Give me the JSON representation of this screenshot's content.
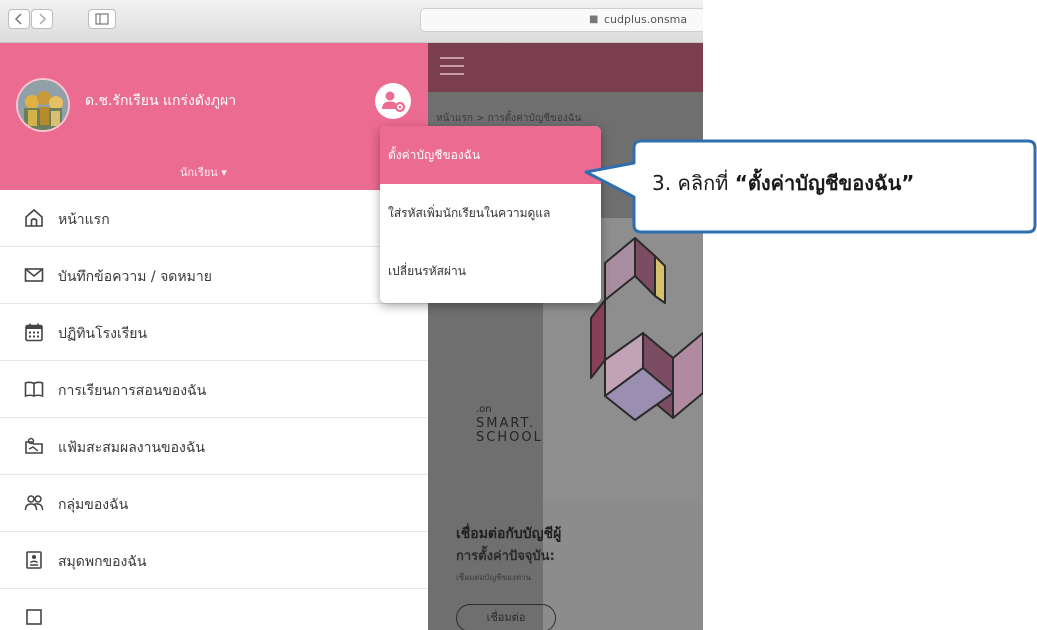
{
  "browser": {
    "url": "cudplus.onsma"
  },
  "sidebar": {
    "user_name": "ด.ช.รักเรียน แกร่งดังภูผา",
    "role": "นักเรียน ▾",
    "items": [
      {
        "label": "หน้าแรก",
        "icon": "home-icon"
      },
      {
        "label": "บันทึกข้อความ / จดหมาย",
        "icon": "mail-icon"
      },
      {
        "label": "ปฏิทินโรงเรียน",
        "icon": "calendar-icon"
      },
      {
        "label": "การเรียนการสอนของฉัน",
        "icon": "book-icon"
      },
      {
        "label": "แฟ้มสะสมผลงานของฉัน",
        "icon": "portfolio-icon"
      },
      {
        "label": "กลุ่มของฉัน",
        "icon": "group-icon"
      },
      {
        "label": "สมุดพกของฉัน",
        "icon": "notebook-icon"
      }
    ]
  },
  "main": {
    "breadcrumb": "หน้าแรก > การตั้งค่าบัญชีของฉัน",
    "logo_on": ".on",
    "logo_line1": "SMART.",
    "logo_line2": "SCHOOL",
    "connect_title": "เชื่อมต่อกับบัญชีผู้",
    "current_setting": "การตั้งค่าปัจจุบัน:",
    "connect_desc": "เชื่อมต่อบัญชีของท่าน",
    "connect_button": "เชื่อมต่อ"
  },
  "dropdown": {
    "items": [
      {
        "label": "ตั้งค่าบัญชีของฉัน",
        "active": true
      },
      {
        "label": "ใส่รหัสเพิ่มนักเรียนในความดูแล",
        "active": false
      },
      {
        "label": "เปลี่ยนรหัสผ่าน",
        "active": false
      }
    ]
  },
  "callout": {
    "prefix": "3. คลิกที่ ",
    "highlight": "“ตั้งค่าบัญชีของฉัน”"
  },
  "colors": {
    "accent_pink": "#ec6b91",
    "topbar_maroon": "#7b3e4f",
    "callout_border": "#2f6fb0"
  }
}
